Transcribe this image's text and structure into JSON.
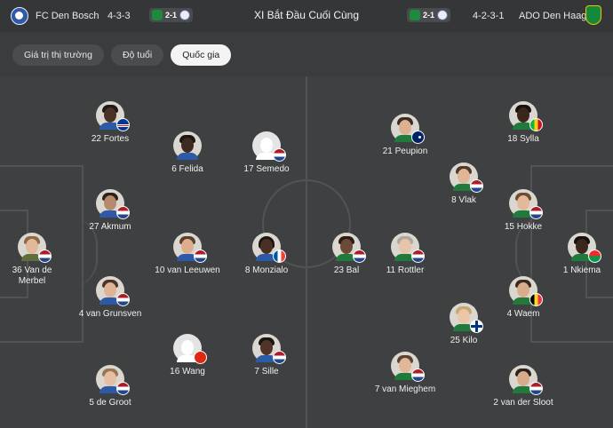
{
  "header": {
    "home_team": "FC Den Bosch",
    "home_formation": "4-3-3",
    "home_score": "2-1",
    "title": "XI Bắt Đầu Cuối Cùng",
    "away_score": "2-1",
    "away_formation": "4-2-3-1",
    "away_team": "ADO Den Haag",
    "home_crest_icon": "den-bosch-crest-icon",
    "away_crest_icon": "ado-den-haag-crest-icon"
  },
  "tabs": [
    {
      "label": "Giá trị thị trường",
      "active": false
    },
    {
      "label": "Độ tuổi",
      "active": false
    },
    {
      "label": "Quốc gia",
      "active": true
    }
  ],
  "colors": {
    "background": "#3b3c3d",
    "pitch": "#3f4041",
    "active_tab": "#f4f4f4"
  },
  "home_players": [
    {
      "label": "22 Fortes",
      "flag": "cape-verde"
    },
    {
      "label": "6 Felida",
      "flag": "none"
    },
    {
      "label": "17 Semedo",
      "flag": "netherlands"
    },
    {
      "label": "27 Akmum",
      "flag": "netherlands"
    },
    {
      "label": "36 Van de Merbel",
      "flag": "netherlands"
    },
    {
      "label": "10 van Leeuwen",
      "flag": "netherlands"
    },
    {
      "label": "8 Monzialo",
      "flag": "france"
    },
    {
      "label": "4 van Grunsven",
      "flag": "netherlands"
    },
    {
      "label": "16 Wang",
      "flag": "china"
    },
    {
      "label": "7 Sille",
      "flag": "netherlands"
    },
    {
      "label": "5 de Groot",
      "flag": "netherlands"
    }
  ],
  "away_players": [
    {
      "label": "18 Sylla",
      "flag": "mali"
    },
    {
      "label": "21 Peupion",
      "flag": "australia"
    },
    {
      "label": "8 Vlak",
      "flag": "netherlands"
    },
    {
      "label": "15 Hokke",
      "flag": "netherlands"
    },
    {
      "label": "23 Bal",
      "flag": "netherlands"
    },
    {
      "label": "11 Rottler",
      "flag": "netherlands"
    },
    {
      "label": "1 Nkiema",
      "flag": "burkina-faso"
    },
    {
      "label": "4 Waem",
      "flag": "belgium"
    },
    {
      "label": "25 Kilo",
      "flag": "finland"
    },
    {
      "label": "7 van Mieghem",
      "flag": "netherlands"
    },
    {
      "label": "2 van der Sloot",
      "flag": "netherlands"
    }
  ]
}
